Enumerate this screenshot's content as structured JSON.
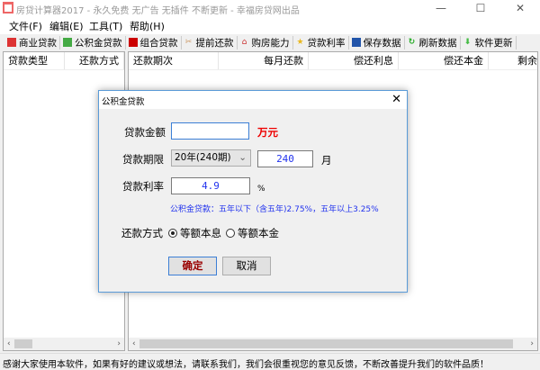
{
  "window": {
    "title": "房贷计算器2017 - 永久免费 无广告 无插件 不断更新 - 幸福房贷网出品"
  },
  "menu": [
    "文件(F)",
    "编辑(E)",
    "工具(T)",
    "帮助(H)"
  ],
  "toolbar": [
    {
      "label": "商业贷款",
      "icon": "bank-icon",
      "color": "#d33"
    },
    {
      "label": "公积金贷款",
      "icon": "fund-icon",
      "color": "#4a4"
    },
    {
      "label": "组合贷款",
      "icon": "combo-icon",
      "color": "#c00"
    },
    {
      "label": "提前还款",
      "icon": "scissors-icon",
      "color": "#c96"
    },
    {
      "label": "购房能力",
      "icon": "house-icon",
      "color": "#c33"
    },
    {
      "label": "贷款利率",
      "icon": "star-icon",
      "color": "#e9b820"
    },
    {
      "label": "保存数据",
      "icon": "save-icon",
      "color": "#2255aa"
    },
    {
      "label": "刷新数据",
      "icon": "refresh-icon",
      "color": "#2a2"
    },
    {
      "label": "软件更新",
      "icon": "download-icon",
      "color": "#4b4"
    }
  ],
  "left_table": {
    "columns": [
      "贷款类型",
      "还款方式"
    ]
  },
  "right_table": {
    "columns": [
      "还款期次",
      "每月还款",
      "偿还利息",
      "偿还本金",
      "剩余"
    ]
  },
  "status": "感谢大家使用本软件，如果有好的建议或想法，请联系我们，我们会很重视您的意见反馈，不断改善提升我们的软件品质！",
  "dialog": {
    "title": "公积金贷款",
    "amount_label": "贷款金额",
    "amount_value": "",
    "amount_unit": "万元",
    "term_label": "贷款期限",
    "term_selected": "20年(240期)",
    "term_months": "240",
    "term_unit": "月",
    "rate_label": "贷款利率",
    "rate_value": "4.9",
    "rate_unit": "%",
    "rate_hint": "公积金贷款：五年以下（含五年)2.75%，五年以上3.25%",
    "method_label": "还款方式",
    "method_options": [
      "等额本息",
      "等额本金"
    ],
    "method_selected": 0,
    "ok": "确定",
    "cancel": "取消"
  }
}
